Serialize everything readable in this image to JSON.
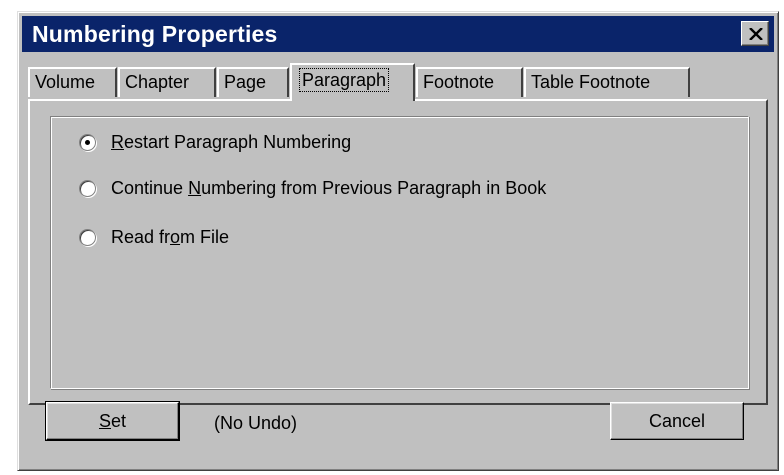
{
  "window": {
    "title": "Numbering Properties",
    "close_icon": "close-icon"
  },
  "tabs": [
    {
      "label": "Volume"
    },
    {
      "label": "Chapter"
    },
    {
      "label": "Page"
    },
    {
      "label": "Paragraph",
      "active": true
    },
    {
      "label": "Footnote"
    },
    {
      "label": "Table Footnote"
    }
  ],
  "options": {
    "restart": {
      "pre": "",
      "key": "R",
      "post": "estart Paragraph Numbering",
      "checked": true
    },
    "continue": {
      "pre": "Continue ",
      "key": "N",
      "post": "umbering from Previous Paragraph in Book",
      "checked": false
    },
    "read": {
      "pre": "Read fr",
      "key": "o",
      "post": "m File",
      "checked": false
    }
  },
  "buttons": {
    "set_key": "S",
    "set_rest": "et",
    "cancel": "Cancel"
  },
  "status": {
    "no_undo": "(No Undo)"
  }
}
